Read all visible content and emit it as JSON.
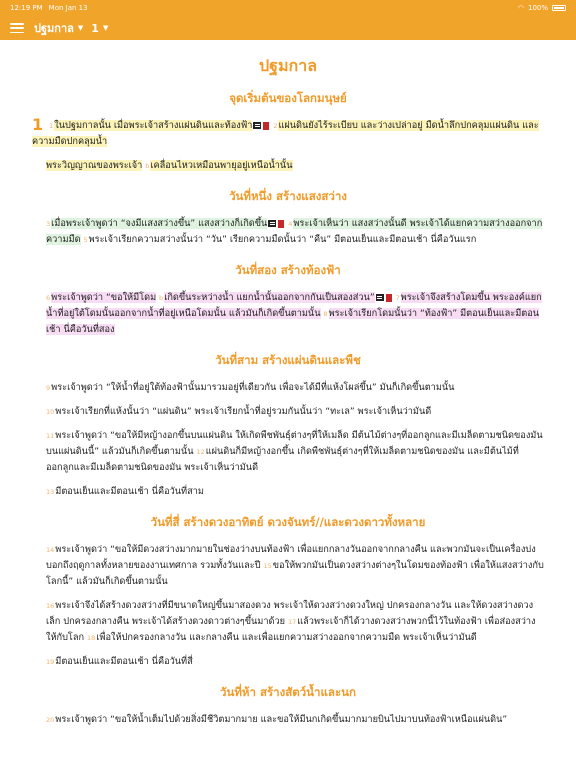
{
  "status": {
    "time": "12:19 PM",
    "date": "Mon Jan 13",
    "battery": "100%"
  },
  "nav": {
    "book": "ปฐมกาล",
    "chapter": "1"
  },
  "book_title": "ปฐมกาล",
  "chapter_number": "1",
  "sections": [
    {
      "title": "จุดเริ่มต้นของโลกมนุษย์",
      "paras": [
        {
          "segments": [
            {
              "num": "1",
              "text": "ในปฐมกาลนั้น เมื่อพระเจ้าสร้างแผ่นดินและท้องฟ้า",
              "hl": "yellow",
              "note": true,
              "bookmark": true
            },
            {
              "num": "2",
              "text": "แผ่นดินยังไร้ระเบียบ และว่างเปล่าอยู่ มืดน้ำลึกปกคลุมแผ่นดิน และความมืดปกคลุมน้ำ",
              "hl": "yellow"
            }
          ]
        },
        {
          "indent": true,
          "segments": [
            {
              "text": "พระวิญญาณของพระเจ้า",
              "hl": "yellow"
            },
            {
              "num": "b",
              "text": "เคลื่อนไหวเหมือนพายุอยู่เหนือน้ำนั้น",
              "hl": "yellow"
            }
          ]
        }
      ]
    },
    {
      "title": "วันที่หนึ่ง สร้างแสงสว่าง",
      "paras": [
        {
          "indent": true,
          "segments": [
            {
              "num": "3",
              "text": "เมื่อพระเจ้าพูดว่า “จงมีแสงสว่างขึ้น” แสงสว่างก็เกิดขึ้น",
              "hl": "green",
              "note": true,
              "bookmark": true
            },
            {
              "num": "4",
              "text": "พระเจ้าเห็นว่า แสงสว่างนั้นดี พระเจ้าได้แยกความสว่างออกจากความมืด",
              "hl": "green"
            },
            {
              "num": "5",
              "text": "พระเจ้าเรียกความสว่างนั้นว่า “วัน” เรียกความมืดนั้นว่า “คืน” มีตอนเย็นและมีตอนเช้า นี่คือวันแรก",
              "hl": ""
            }
          ]
        }
      ]
    },
    {
      "title": "วันที่สอง สร้างท้องฟ้า",
      "paras": [
        {
          "indent": true,
          "segments": [
            {
              "num": "6",
              "text": "พระเจ้าพูดว่า “ขอให้มีโดม",
              "hl": "pink"
            },
            {
              "num": "b",
              "text": "เกิดขึ้นระหว่างน้ำ แยกน้ำนั้นออกจากกันเป็นสองส่วน”",
              "hl": "pink",
              "note": true,
              "bookmark": true
            },
            {
              "num": "7",
              "text": "พระเจ้าจึงสร้างโดมขึ้น พระองค์แยกน้ำที่อยู่ใต้โดมนั้นออกจากน้ำที่อยู่เหนือโดมนั้น แล้วมันก็เกิดขึ้นตามนั้น",
              "hl": "pink"
            },
            {
              "num": "8",
              "text": "พระเจ้าเรียกโดมนั้นว่า “ท้องฟ้า” มีตอนเย็นและมีตอนเช้า นี่คือวันที่สอง",
              "hl": "pink"
            }
          ]
        }
      ]
    },
    {
      "title": "วันที่สาม สร้างแผ่นดินและพืช",
      "paras": [
        {
          "indent": true,
          "segments": [
            {
              "num": "9",
              "text": "พระเจ้าพูดว่า “ให้น้ำที่อยู่ใต้ท้องฟ้านั้นมารวมอยู่ที่เดียวกัน เพื่อจะได้มีที่แห้งโผล่ขึ้น” มันก็เกิดขึ้นตามนั้น",
              "hl": ""
            }
          ]
        },
        {
          "indent": true,
          "segments": [
            {
              "num": "10",
              "text": "พระเจ้าเรียกที่แห้งนั้นว่า “แผ่นดิน” พระเจ้าเรียกน้ำที่อยู่รวมกันนั้นว่า “ทะเล” พระเจ้าเห็นว่ามันดี",
              "hl": ""
            }
          ]
        },
        {
          "indent": true,
          "segments": [
            {
              "num": "11",
              "text": "พระเจ้าพูดว่า “ขอให้มีหญ้างอกขึ้นบนแผ่นดิน ให้เกิดพืชพันธุ์ต่างๆที่ให้เมล็ด มีต้นไม้ต่างๆที่ออกลูกและมีเมล็ดตามชนิดของมันบนแผ่นดินนี้” แล้วมันก็เกิดขึ้นตามนั้น",
              "hl": ""
            },
            {
              "num": "12",
              "text": "แผ่นดินก็มีหญ้างอกขึ้น เกิดพืชพันธุ์ต่างๆที่ให้เมล็ดตามชนิดของมัน และมีต้นไม้ที่ออกลูกและมีเมล็ดตามชนิดของมัน พระเจ้าเห็นว่ามันดี",
              "hl": ""
            }
          ]
        },
        {
          "indent": true,
          "segments": [
            {
              "num": "13",
              "text": "มีตอนเย็นและมีตอนเช้า นี่คือวันที่สาม",
              "hl": ""
            }
          ]
        }
      ]
    },
    {
      "title": "วันที่สี่ สร้างดวงอาทิตย์ ดวงจันทร์//และดวงดาวทั้งหลาย",
      "paras": [
        {
          "indent": true,
          "segments": [
            {
              "num": "14",
              "text": "พระเจ้าพูดว่า “ขอให้มีดวงสว่างมากมายในช่องว่างบนท้องฟ้า เพื่อแยกกลางวันออกจากกลางคืน และพวกมันจะเป็นเครื่องบ่งบอกถึงฤดูกาลทั้งหลายของงานเทศกาล รวมทั้งวันและปี",
              "hl": ""
            },
            {
              "num": "15",
              "text": "ขอให้พวกมันเป็นดวงสว่างต่างๆในโดมของท้องฟ้า เพื่อให้แสงสว่างกับโลกนี้” แล้วมันก็เกิดขึ้นตามนั้น",
              "hl": ""
            }
          ]
        },
        {
          "indent": true,
          "segments": [
            {
              "num": "16",
              "text": "พระเจ้าจึงได้สร้างดวงสว่างที่มีขนาดใหญ่ขึ้นมาสองดวง พระเจ้าให้ดวงสว่างดวงใหญ่ ปกครองกลางวัน และให้ดวงสว่างดวงเล็ก ปกครองกลางคืน พระเจ้าได้สร้างดวงดาวต่างๆขึ้นมาด้วย",
              "hl": ""
            },
            {
              "num": "17",
              "text": "แล้วพระเจ้าก็ได้วางดวงสว่างพวกนี้ไว้ในท้องฟ้า เพื่อส่องสว่างให้กับโลก",
              "hl": ""
            },
            {
              "num": "18",
              "text": "เพื่อให้ปกครองกลางวัน และกลางคืน และเพื่อแยกความสว่างออกจากความมืด พระเจ้าเห็นว่ามันดี",
              "hl": ""
            }
          ]
        },
        {
          "indent": true,
          "segments": [
            {
              "num": "19",
              "text": "มีตอนเย็นและมีตอนเช้า นี่คือวันที่สี่",
              "hl": ""
            }
          ]
        }
      ]
    },
    {
      "title": "วันที่ห้า สร้างสัตว์น้ำและนก",
      "paras": [
        {
          "indent": true,
          "segments": [
            {
              "num": "20",
              "text": "พระเจ้าพูดว่า “ขอให้น้ำเต็มไปด้วยสิ่งมีชีวิตมากมาย และขอให้มีนกเกิดขึ้นมากมายบินไปมาบนท้องฟ้าเหนือแผ่นดิน”",
              "hl": ""
            }
          ]
        }
      ]
    }
  ]
}
